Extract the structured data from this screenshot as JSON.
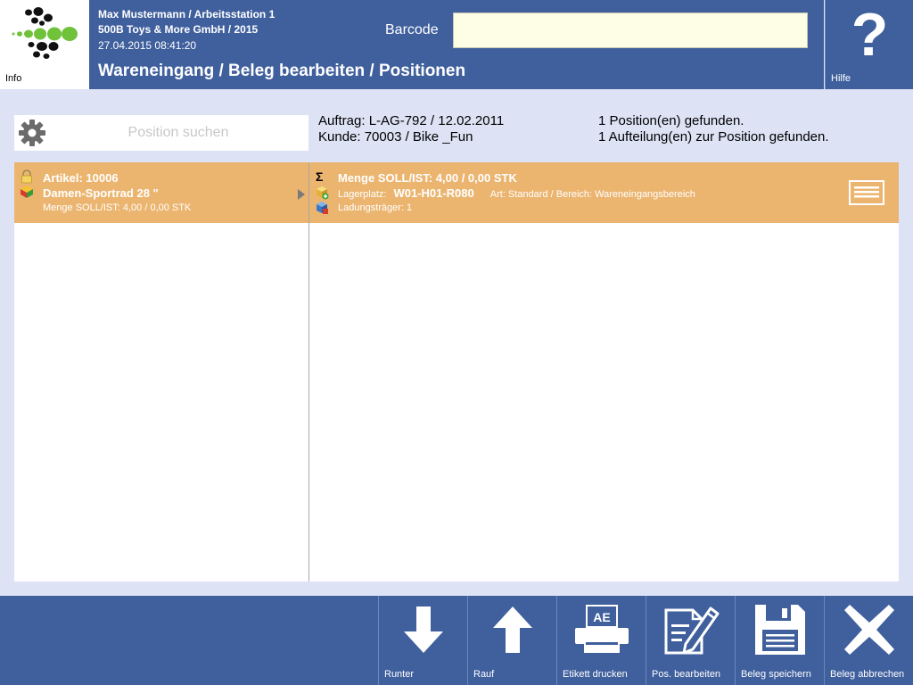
{
  "header": {
    "info_label": "Info",
    "user_line": "Max Mustermann / Arbeitsstation 1",
    "company_line": "500B Toys & More GmbH / 2015",
    "datetime_line": "27.04.2015 08:41:20",
    "barcode_label": "Barcode",
    "barcode_value": "",
    "page_title": "Wareneingang / Beleg bearbeiten / Positionen",
    "help_label": "Hilfe",
    "help_symbol": "?"
  },
  "search": {
    "placeholder": "Position suchen"
  },
  "order_info": {
    "order_line": "Auftrag: L-AG-792 / 12.02.2011",
    "customer_line": "Kunde: 70003 / Bike _Fun"
  },
  "results": {
    "positions_found": "1 Position(en) gefunden.",
    "splits_found": "1 Aufteilung(en) zur Position gefunden."
  },
  "position_list": [
    {
      "article": "Artikel: 10006",
      "name": "Damen-Sportrad 28 \"",
      "quantity": "Menge SOLL/IST: 4,00 / 0,00 STK"
    }
  ],
  "split_list": [
    {
      "sigma": "Σ",
      "quantity": "Menge SOLL/IST: 4,00 / 0,00 STK",
      "storage_label": "Lagerplatz:",
      "storage_code": "W01-H01-R080",
      "storage_type": "Art: Standard / Bereich: Wareneingangsbereich",
      "carrier": "Ladungsträger: 1"
    }
  ],
  "footer": {
    "down_label": "Runter",
    "up_label": "Rauf",
    "print_label": "Etikett drucken",
    "print_badge": "AE",
    "edit_label": "Pos. bearbeiten",
    "save_label": "Beleg speichern",
    "cancel_label": "Beleg abbrechen"
  },
  "colors": {
    "header_blue": "#3f5f9d",
    "background": "#dde3f5",
    "selected_row": "#ebb570",
    "barcode_field": "#fefee6",
    "logo_green": "#6fc23a"
  }
}
